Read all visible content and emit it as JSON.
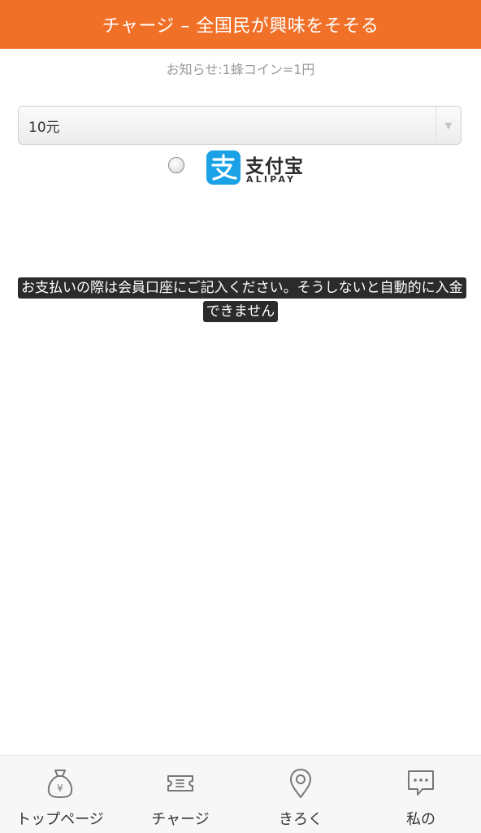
{
  "header": {
    "title": "チャージ – 全国民が興味をそそる"
  },
  "notice": "お知らせ:1蜂コイン=1円",
  "amount_select": {
    "selected": "10元"
  },
  "payment": {
    "method_cn": "支付宝",
    "method_en": "ALIPAY",
    "brand_color": "#1aa1e6"
  },
  "warning": "お支払いの際は会員口座にご記入ください。そうしないと自動的に入金できません",
  "tabbar": {
    "items": [
      {
        "label": "トップページ",
        "icon": "money-bag-icon"
      },
      {
        "label": "チャージ",
        "icon": "ticket-icon"
      },
      {
        "label": "きろく",
        "icon": "location-pin-icon"
      },
      {
        "label": "私の",
        "icon": "chat-bubble-icon"
      }
    ]
  },
  "colors": {
    "accent": "#f07028"
  }
}
